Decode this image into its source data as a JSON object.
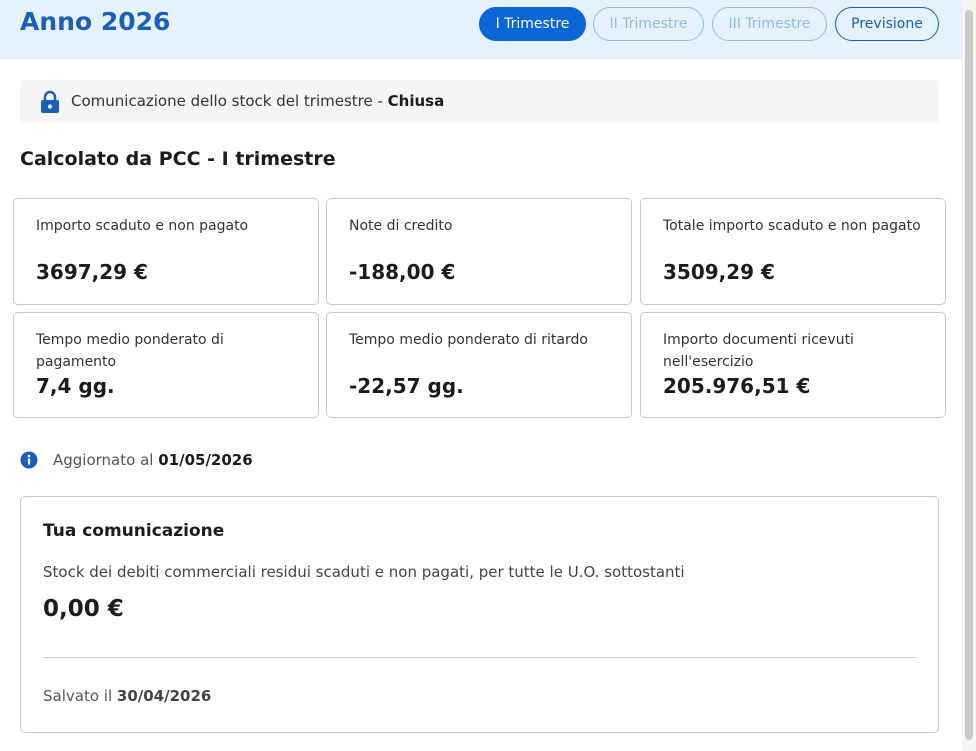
{
  "header": {
    "title": "Anno 2026",
    "tabs": [
      {
        "label": "I Trimestre",
        "state": "active"
      },
      {
        "label": "II Trimestre",
        "state": "disabled"
      },
      {
        "label": "III Trimestre",
        "state": "disabled"
      },
      {
        "label": "Previsione",
        "state": "enabled"
      }
    ]
  },
  "status": {
    "icon": "lock-icon",
    "text": "Comunicazione dello stock del trimestre - ",
    "state": "Chiusa"
  },
  "section_title": "Calcolato da PCC - I trimestre",
  "cards": [
    {
      "label": "Importo scaduto e non pagato",
      "value": "3697,29 €"
    },
    {
      "label": "Note di credito",
      "value": "-188,00 €"
    },
    {
      "label": "Totale importo scaduto e non pagato",
      "value": "3509,29 €"
    },
    {
      "label": "Tempo medio ponderato di pagamento",
      "value": "7,4 gg."
    },
    {
      "label": "Tempo medio ponderato di ritardo",
      "value": "-22,57 gg."
    },
    {
      "label": "Importo documenti ricevuti nell'esercizio",
      "value": "205.976,51 €"
    }
  ],
  "update_info": {
    "icon": "info-icon",
    "label": "Aggiornato al ",
    "date": "01/05/2026"
  },
  "communication": {
    "title": "Tua comunicazione",
    "description": "Stock dei debiti commerciali residui scaduti e non pagati, per tutte le U.O. sottostanti",
    "value": "0,00 €",
    "saved_label": "Salvato il ",
    "saved_date": "30/04/2026"
  },
  "colors": {
    "primary": "#0a66d6",
    "header_bg": "#e5f1fc",
    "disabled": "#8ebbe6"
  }
}
